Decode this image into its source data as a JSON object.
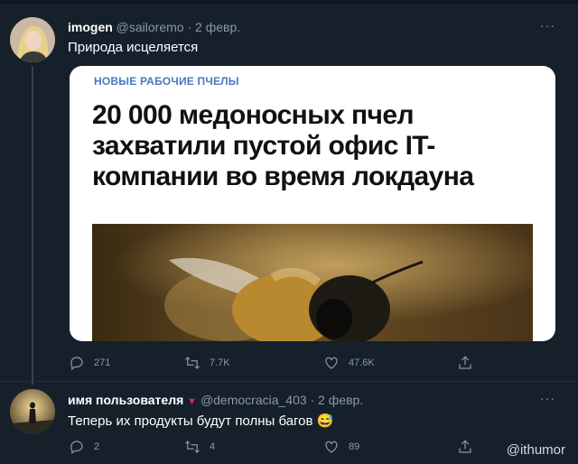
{
  "tweet1": {
    "display_name": "imogen",
    "handle": "@sailoremo",
    "separator": "·",
    "date": "2 февр.",
    "more": "···",
    "text": "Природа исцеляется",
    "card": {
      "kicker": "НОВЫЕ РАБОЧИЕ ПЧЕЛЫ",
      "headline": "20 000 медоносных пчел захватили пустой офис IT-компании во время локдауна"
    },
    "actions": {
      "replies": "271",
      "retweets": "7.7K",
      "likes": "47.6K"
    }
  },
  "tweet2": {
    "display_name": "имя пользователя",
    "badge": "▼",
    "handle": "@democracia_403",
    "separator": "·",
    "date": "2 февр.",
    "more": "···",
    "text": "Теперь их продукты будут полны багов",
    "emoji": "😅",
    "actions": {
      "replies": "2",
      "retweets": "4",
      "likes": "89"
    }
  },
  "watermark": "@ithumor",
  "colors": {
    "background": "#15202b",
    "icon_gray": "#8b98a5",
    "badge_red": "#e0245e",
    "card_kicker": "#4a78c2"
  }
}
